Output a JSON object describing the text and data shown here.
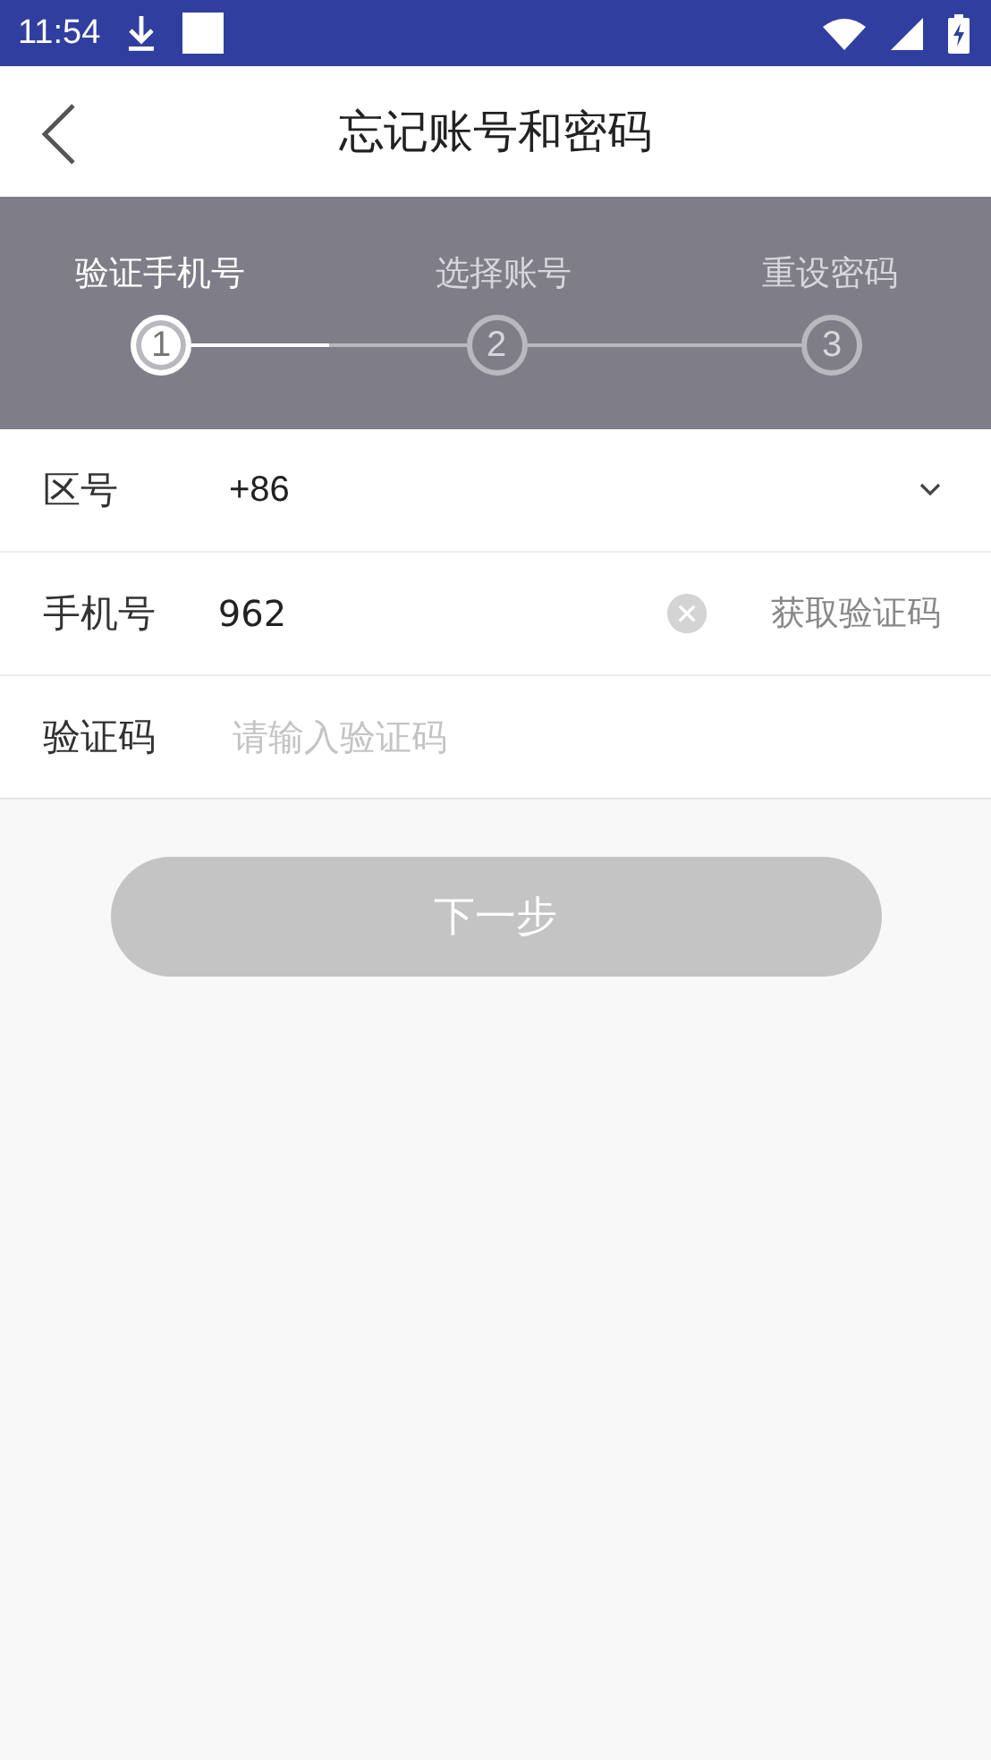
{
  "status_bar": {
    "time": "11:54"
  },
  "header": {
    "title": "忘记账号和密码"
  },
  "steps": [
    {
      "label": "验证手机号",
      "number": "1",
      "selected": true
    },
    {
      "label": "选择账号",
      "number": "2",
      "selected": false
    },
    {
      "label": "重设密码",
      "number": "3",
      "selected": false
    }
  ],
  "connectors": [
    {
      "level": 0.5
    }
  ],
  "form": {
    "rows": [
      {
        "kind": "select",
        "label": "区号",
        "value": "+86"
      },
      {
        "kind": "phone",
        "label": "手机号",
        "value": "962",
        "action": "获取验证码"
      },
      {
        "kind": "code",
        "label": "验证码",
        "placeholder": "请输入验证码"
      }
    ]
  },
  "next_button": {
    "label": "下一步",
    "disabled": true
  }
}
